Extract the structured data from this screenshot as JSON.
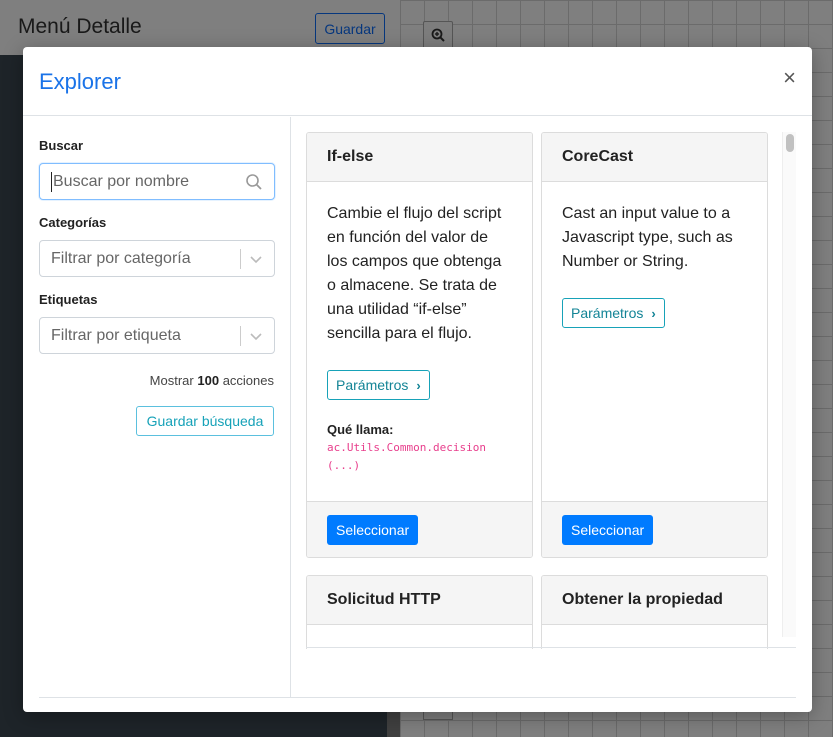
{
  "background": {
    "title": "Menú Detalle",
    "save_label": "Guardar"
  },
  "modal": {
    "title": "Explorer",
    "close": "×"
  },
  "sidebar": {
    "search_label": "Buscar",
    "search_placeholder": "Buscar por nombre",
    "categories_label": "Categorías",
    "categories_placeholder": "Filtrar por categoría",
    "tags_label": "Etiquetas",
    "tags_placeholder": "Filtrar por etiqueta",
    "show_prefix": "Mostrar",
    "show_count": "100",
    "show_suffix": "acciones",
    "save_search_label": "Guardar búsqueda"
  },
  "cards": [
    {
      "title": "If-else",
      "description": "Cambie el flujo del script en función del valor de los campos que obtenga o almacene. Se trata de una utilidad “if-else” sencilla para el flujo.",
      "params_label": "Parámetros",
      "calls_label": "Qué llama:",
      "calls_code": "ac.Utils.Common.decision(...)",
      "select_label": "Seleccionar"
    },
    {
      "title": "CoreCast",
      "description": "Cast an input value to a Javascript type, such as Number or String.",
      "params_label": "Parámetros",
      "select_label": "Seleccionar"
    },
    {
      "title": "Solicitud HTTP"
    },
    {
      "title": "Obtener la propiedad"
    }
  ]
}
